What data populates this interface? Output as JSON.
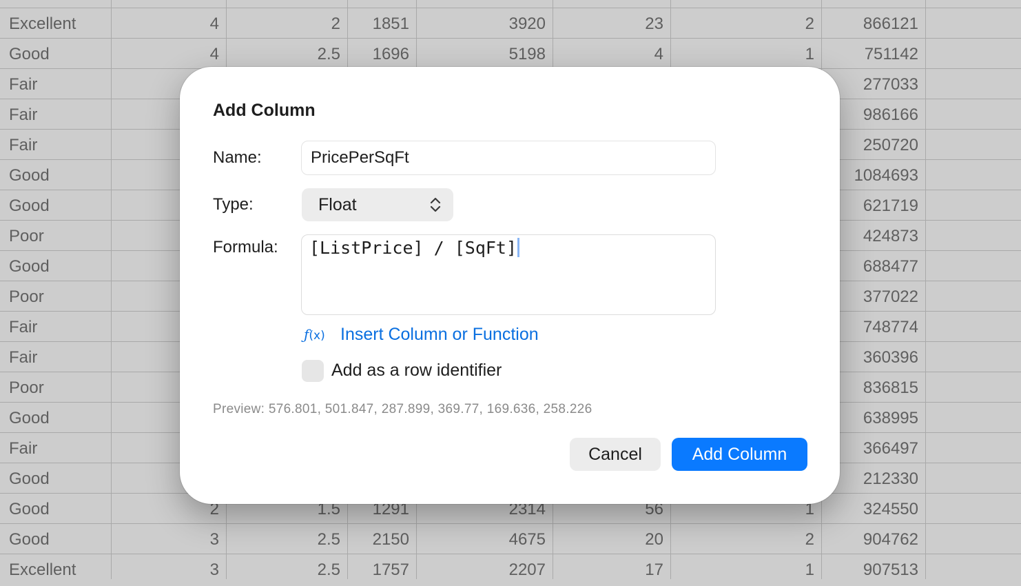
{
  "sheet": {
    "rows": [
      [
        "Excellent",
        "4",
        "2",
        "1851",
        "3920",
        "23",
        "2",
        "866121"
      ],
      [
        "Good",
        "4",
        "2.5",
        "1696",
        "5198",
        "4",
        "1",
        "751142"
      ],
      [
        "Fair",
        "",
        "",
        "",
        "",
        "",
        "",
        "277033"
      ],
      [
        "Fair",
        "",
        "",
        "",
        "",
        "",
        "",
        "986166"
      ],
      [
        "Fair",
        "",
        "",
        "",
        "",
        "",
        "",
        "250720"
      ],
      [
        "Good",
        "",
        "",
        "",
        "",
        "",
        "",
        "1084693"
      ],
      [
        "Good",
        "",
        "",
        "",
        "",
        "",
        "",
        "621719"
      ],
      [
        "Poor",
        "",
        "",
        "",
        "",
        "",
        "",
        "424873"
      ],
      [
        "Good",
        "",
        "",
        "",
        "",
        "",
        "",
        "688477"
      ],
      [
        "Poor",
        "",
        "",
        "",
        "",
        "",
        "",
        "377022"
      ],
      [
        "Fair",
        "",
        "",
        "",
        "",
        "",
        "",
        "748774"
      ],
      [
        "Fair",
        "",
        "",
        "",
        "",
        "",
        "",
        "360396"
      ],
      [
        "Poor",
        "",
        "",
        "",
        "",
        "",
        "",
        "836815"
      ],
      [
        "Good",
        "",
        "",
        "",
        "",
        "",
        "",
        "638995"
      ],
      [
        "Fair",
        "",
        "",
        "",
        "",
        "",
        "",
        "366497"
      ],
      [
        "Good",
        "",
        "",
        "",
        "",
        "",
        "",
        "212330"
      ],
      [
        "Good",
        "2",
        "1.5",
        "1291",
        "2314",
        "56",
        "1",
        "324550"
      ],
      [
        "Good",
        "3",
        "2.5",
        "2150",
        "4675",
        "20",
        "2",
        "904762"
      ],
      [
        "Excellent",
        "3",
        "2.5",
        "1757",
        "2207",
        "17",
        "1",
        "907513"
      ]
    ]
  },
  "dialog": {
    "title": "Add Column",
    "name_label": "Name:",
    "name_value": "PricePerSqFt",
    "type_label": "Type:",
    "type_value": "Float",
    "formula_label": "Formula:",
    "formula_value": "[ListPrice] / [SqFt]",
    "fx_icon_text": "ƒ",
    "fx_icon_paren": "(x)",
    "insert_link": "Insert Column or Function",
    "checkbox_label": "Add as a row identifier",
    "checkbox_checked": false,
    "preview": "Preview: 576.801, 501.847, 287.899, 369.77, 169.636, 258.226",
    "cancel_label": "Cancel",
    "add_label": "Add Column"
  },
  "colors": {
    "accent": "#0a7aff",
    "link": "#0a6fe0"
  }
}
